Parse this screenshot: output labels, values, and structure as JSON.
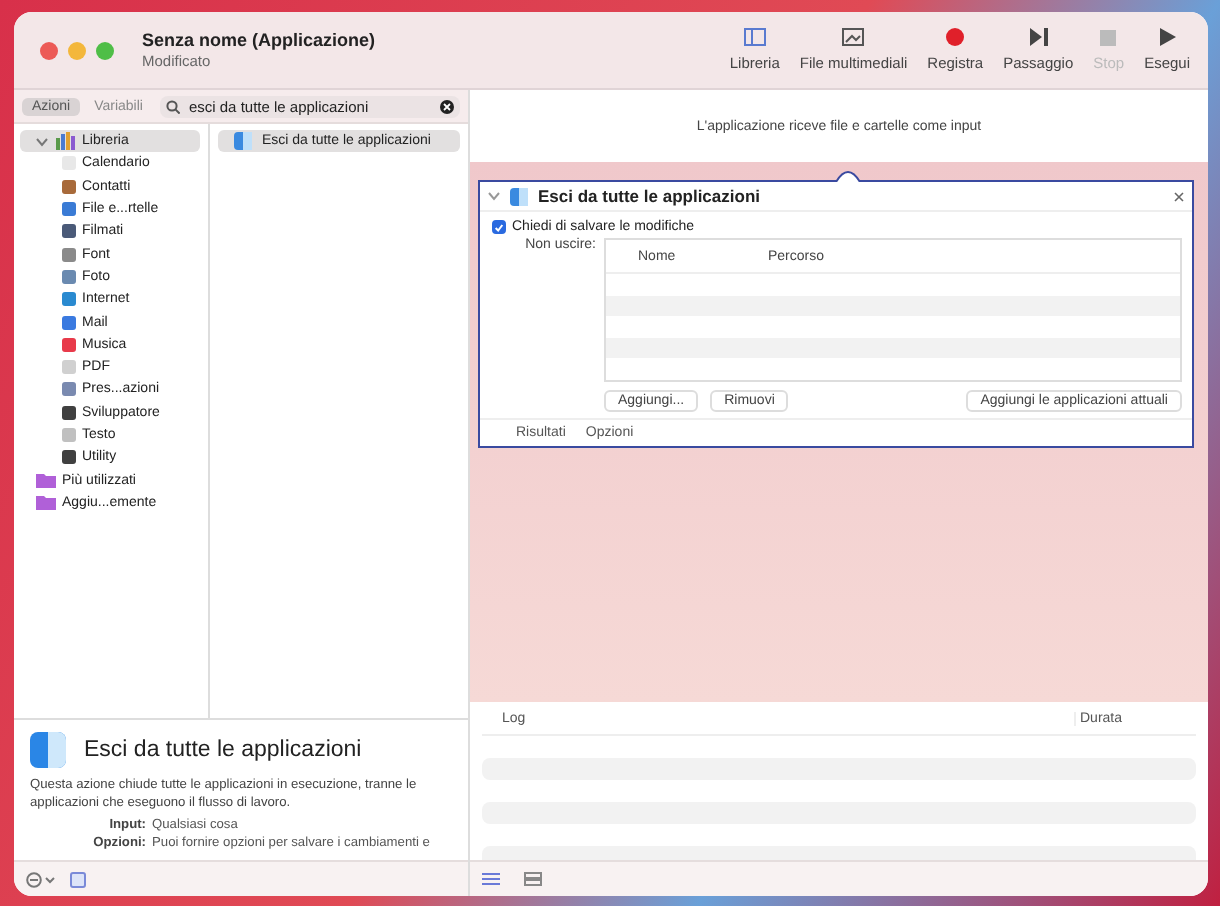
{
  "window": {
    "title": "Senza nome (Applicazione)",
    "subtitle": "Modificato"
  },
  "toolbar": [
    {
      "kind": "library",
      "label": "Libreria",
      "disabled": false
    },
    {
      "kind": "media",
      "label": "File multimediali",
      "disabled": false
    },
    {
      "kind": "record",
      "label": "Registra",
      "disabled": false
    },
    {
      "kind": "step",
      "label": "Passaggio",
      "disabled": false
    },
    {
      "kind": "stop",
      "label": "Stop",
      "disabled": true
    },
    {
      "kind": "run",
      "label": "Esegui",
      "disabled": false
    }
  ],
  "tabs": [
    {
      "label": "Azioni",
      "selected": true
    },
    {
      "label": "Variabili",
      "selected": false
    }
  ],
  "search": {
    "value": "esci da tutte le applicazioni"
  },
  "library": [
    {
      "label": "Libreria",
      "kind": "library",
      "selected": true,
      "expanded": true,
      "children": [
        {
          "label": "Calendario"
        },
        {
          "label": "Contatti"
        },
        {
          "label": "File e...rtelle"
        },
        {
          "label": "Filmati"
        },
        {
          "label": "Font"
        },
        {
          "label": "Foto"
        },
        {
          "label": "Internet"
        },
        {
          "label": "Mail"
        },
        {
          "label": "Musica"
        },
        {
          "label": "PDF"
        },
        {
          "label": "Pres...azioni"
        },
        {
          "label": "Sviluppatore"
        },
        {
          "label": "Testo"
        },
        {
          "label": "Utility"
        }
      ]
    },
    {
      "label": "Più utilizzati",
      "kind": "folder",
      "selected": false
    },
    {
      "label": "Aggiu...emente",
      "kind": "folder",
      "selected": false
    }
  ],
  "actions": [
    {
      "label": "Esci da tutte le applicazioni",
      "selected": true
    }
  ],
  "description": {
    "title": "Esci da tutte le applicazioni",
    "text": "Questa azione chiude tutte le applicazioni in esecuzione, tranne le applicazioni che eseguono il flusso di lavoro.",
    "fields": [
      {
        "label": "Input:",
        "value": "Qualsiasi cosa"
      },
      {
        "label": "Opzioni:",
        "value": "Puoi fornire opzioni per salvare i cambiamenti e"
      }
    ]
  },
  "workflow": {
    "input_note": "L'applicazione riceve file e cartelle come input",
    "action": {
      "title": "Esci da tutte le applicazioni",
      "expanded": true,
      "checkbox": {
        "label": "Chiedi di salvare le modifiche",
        "checked": true
      },
      "exclude_label": "Non uscire:",
      "columns": [
        "Nome",
        "Percorso"
      ],
      "buttons": [
        "Aggiungi...",
        "Rimuovi"
      ],
      "add_current": "Aggiungi le applicazioni attuali",
      "footer_tabs": [
        "Risultati",
        "Opzioni"
      ]
    }
  },
  "log": {
    "columns": [
      "Log",
      "Durata"
    ]
  }
}
